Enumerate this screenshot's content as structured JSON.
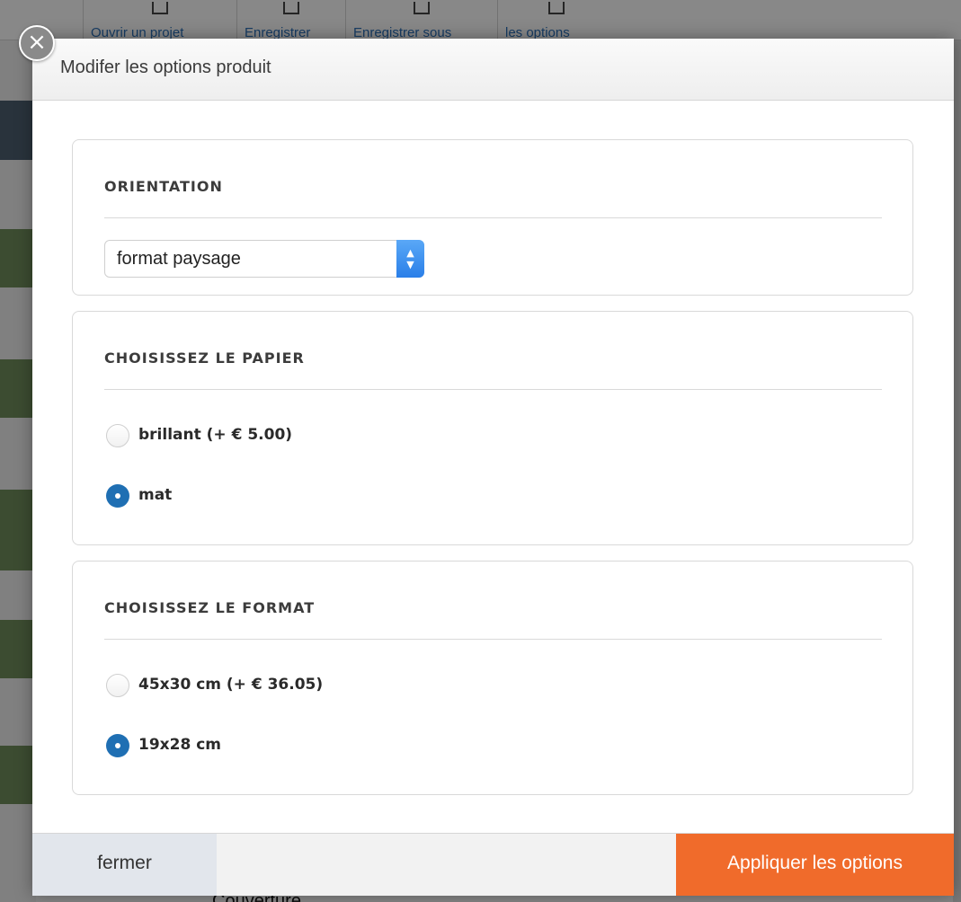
{
  "background": {
    "toolbar": [
      {
        "label": "Ouvrir un projet",
        "icon": "folder-icon"
      },
      {
        "label": "Enregistrer",
        "icon": "save-icon"
      },
      {
        "label": "Enregistrer sous",
        "icon": "save-as-icon"
      },
      {
        "label": "les options",
        "icon": "gear-icon"
      }
    ],
    "bottom_label": "Couverture"
  },
  "modal": {
    "title": "Modifer les options produit",
    "close_icon": "close-icon",
    "sections": {
      "orientation": {
        "title": "ORIENTATION",
        "selected": "format paysage"
      },
      "paper": {
        "title": "CHOISISSEZ LE PAPIER",
        "options": [
          {
            "label": "brillant (+ € 5.00)",
            "checked": false
          },
          {
            "label": "mat",
            "checked": true
          }
        ]
      },
      "format": {
        "title": "CHOISISSEZ LE FORMAT",
        "options": [
          {
            "label": "45x30 cm (+ € 36.05)",
            "checked": false
          },
          {
            "label": "19x28 cm",
            "checked": true
          }
        ]
      }
    },
    "footer": {
      "close_label": "fermer",
      "apply_label": "Appliquer les options"
    }
  },
  "colors": {
    "accent": "#f06b2b",
    "radio_selected": "#1f6fb3",
    "select_arrow": "#2a7fe8"
  }
}
